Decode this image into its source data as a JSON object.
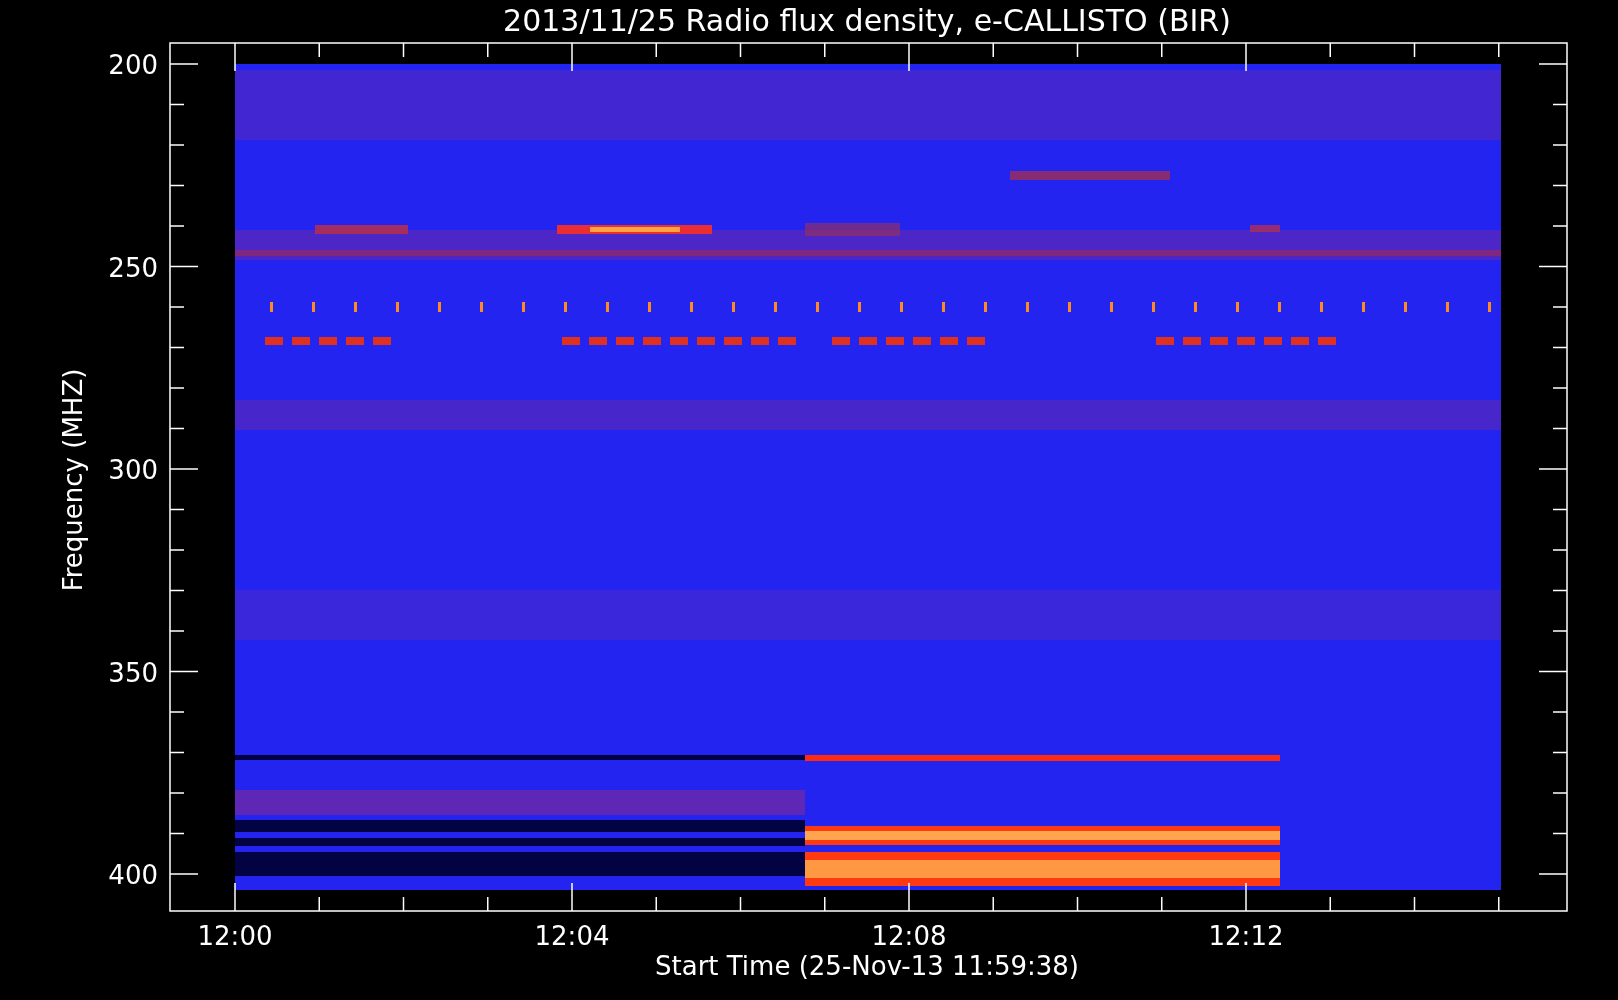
{
  "plot": {
    "title": "2013/11/25  Radio flux density, e-CALLISTO (BIR)",
    "ylabel": "Frequency (MHZ)",
    "xlabel": "Start Time (25-Nov-13 11:59:38)",
    "y_tick_labels": [
      "200",
      "250",
      "300",
      "350",
      "400"
    ],
    "x_tick_labels": [
      "12:00",
      "12:04",
      "12:08",
      "12:12"
    ]
  }
}
